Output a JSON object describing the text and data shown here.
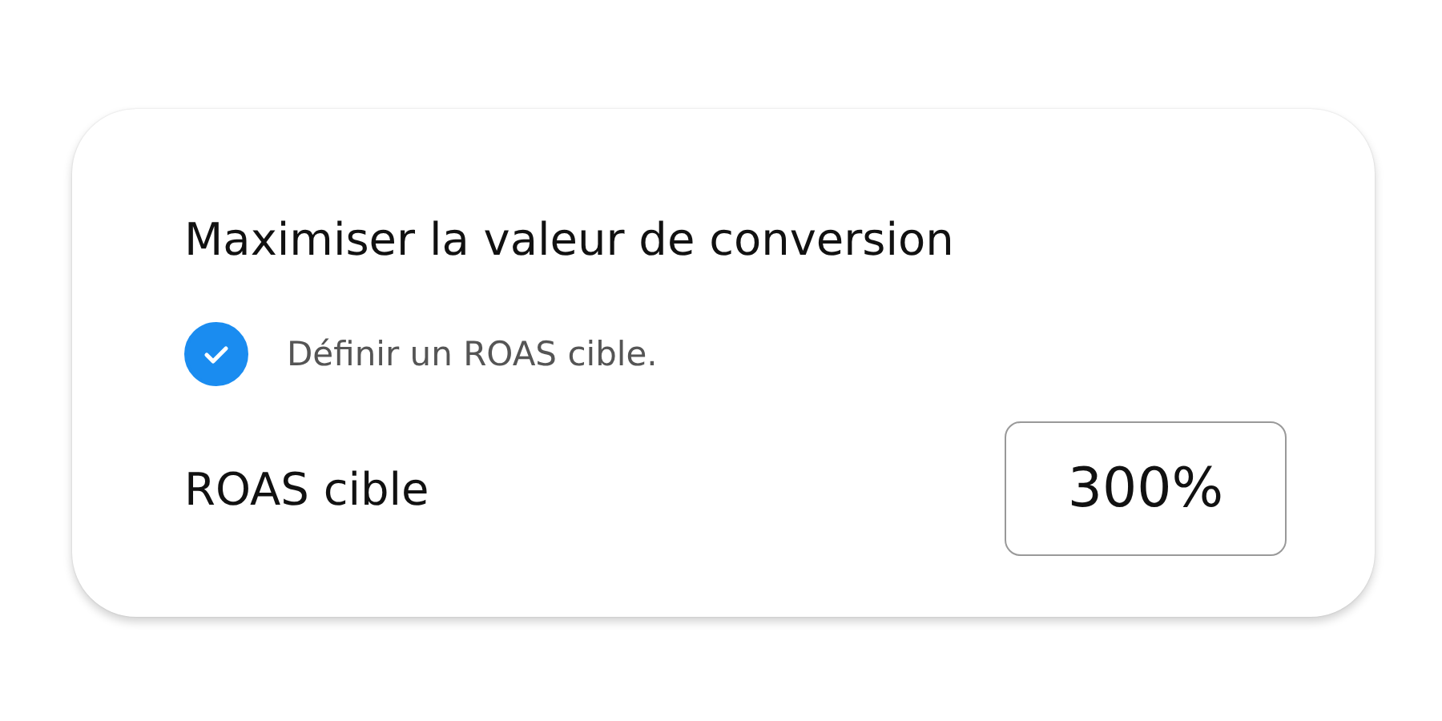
{
  "card": {
    "title": "Maximiser la valeur de conversion",
    "option": {
      "label": "Définir un ROAS cible.",
      "checked": true
    },
    "field": {
      "label": "ROAS cible",
      "value": "300%"
    }
  }
}
